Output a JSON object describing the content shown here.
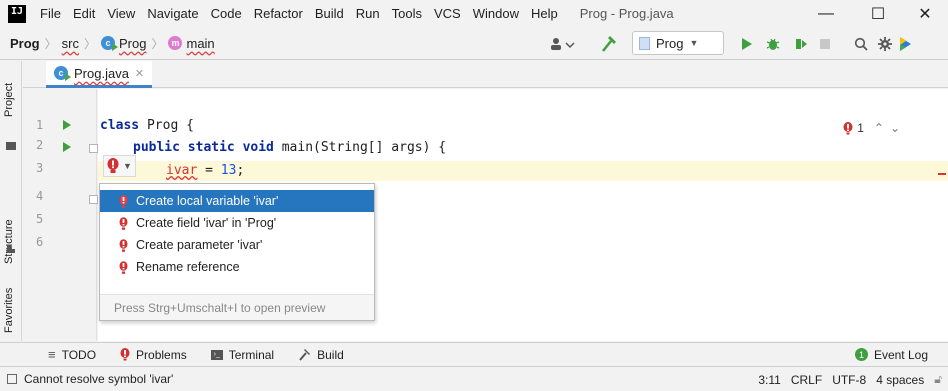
{
  "menu": {
    "logo": "IJ",
    "items": [
      "File",
      "Edit",
      "View",
      "Navigate",
      "Code",
      "Refactor",
      "Build",
      "Run",
      "Tools",
      "VCS",
      "Window",
      "Help"
    ],
    "window_title": "Prog - Prog.java"
  },
  "window_controls": {
    "minimize": "—",
    "maximize": "☐",
    "close": "✕"
  },
  "breadcrumb": {
    "project": "Prog",
    "src": "src",
    "class": "Prog",
    "method": "main"
  },
  "run_config": {
    "name": "Prog"
  },
  "sidebar_left": {
    "top_tab": "Project",
    "mid_tab": "Structure",
    "bottom_tab": "Favorites"
  },
  "editor": {
    "tab_label": "Prog.java",
    "line_numbers": [
      "1",
      "2",
      "3",
      "4",
      "5",
      "6"
    ],
    "code": {
      "l1_kw": "class",
      "l1_rest": " Prog {",
      "l2_kw": "public static void",
      "l2_rest": " main(String[] args) {",
      "l3_var": "ivar",
      "l3_eq": " = ",
      "l3_num": "13",
      "l3_end": ";"
    },
    "error_count": "1"
  },
  "quickfix_popup": {
    "items": [
      "Create local variable 'ivar'",
      "Create field 'ivar' in 'Prog'",
      "Create parameter 'ivar'",
      "Rename reference"
    ],
    "selected_index": 0,
    "hint": "Press Strg+Umschalt+I to open preview"
  },
  "tool_windows": {
    "todo": "TODO",
    "problems": "Problems",
    "terminal": "Terminal",
    "build": "Build",
    "event_log": "Event Log",
    "event_log_count": "1"
  },
  "status": {
    "message": "Cannot resolve symbol 'ivar'",
    "position": "3:11",
    "line_sep": "CRLF",
    "encoding": "UTF-8",
    "indent": "4 spaces"
  },
  "colors": {
    "selection": "#2675bf",
    "error": "#e03030",
    "keyword": "#0a2a99",
    "run_green": "#3f9f3f"
  }
}
